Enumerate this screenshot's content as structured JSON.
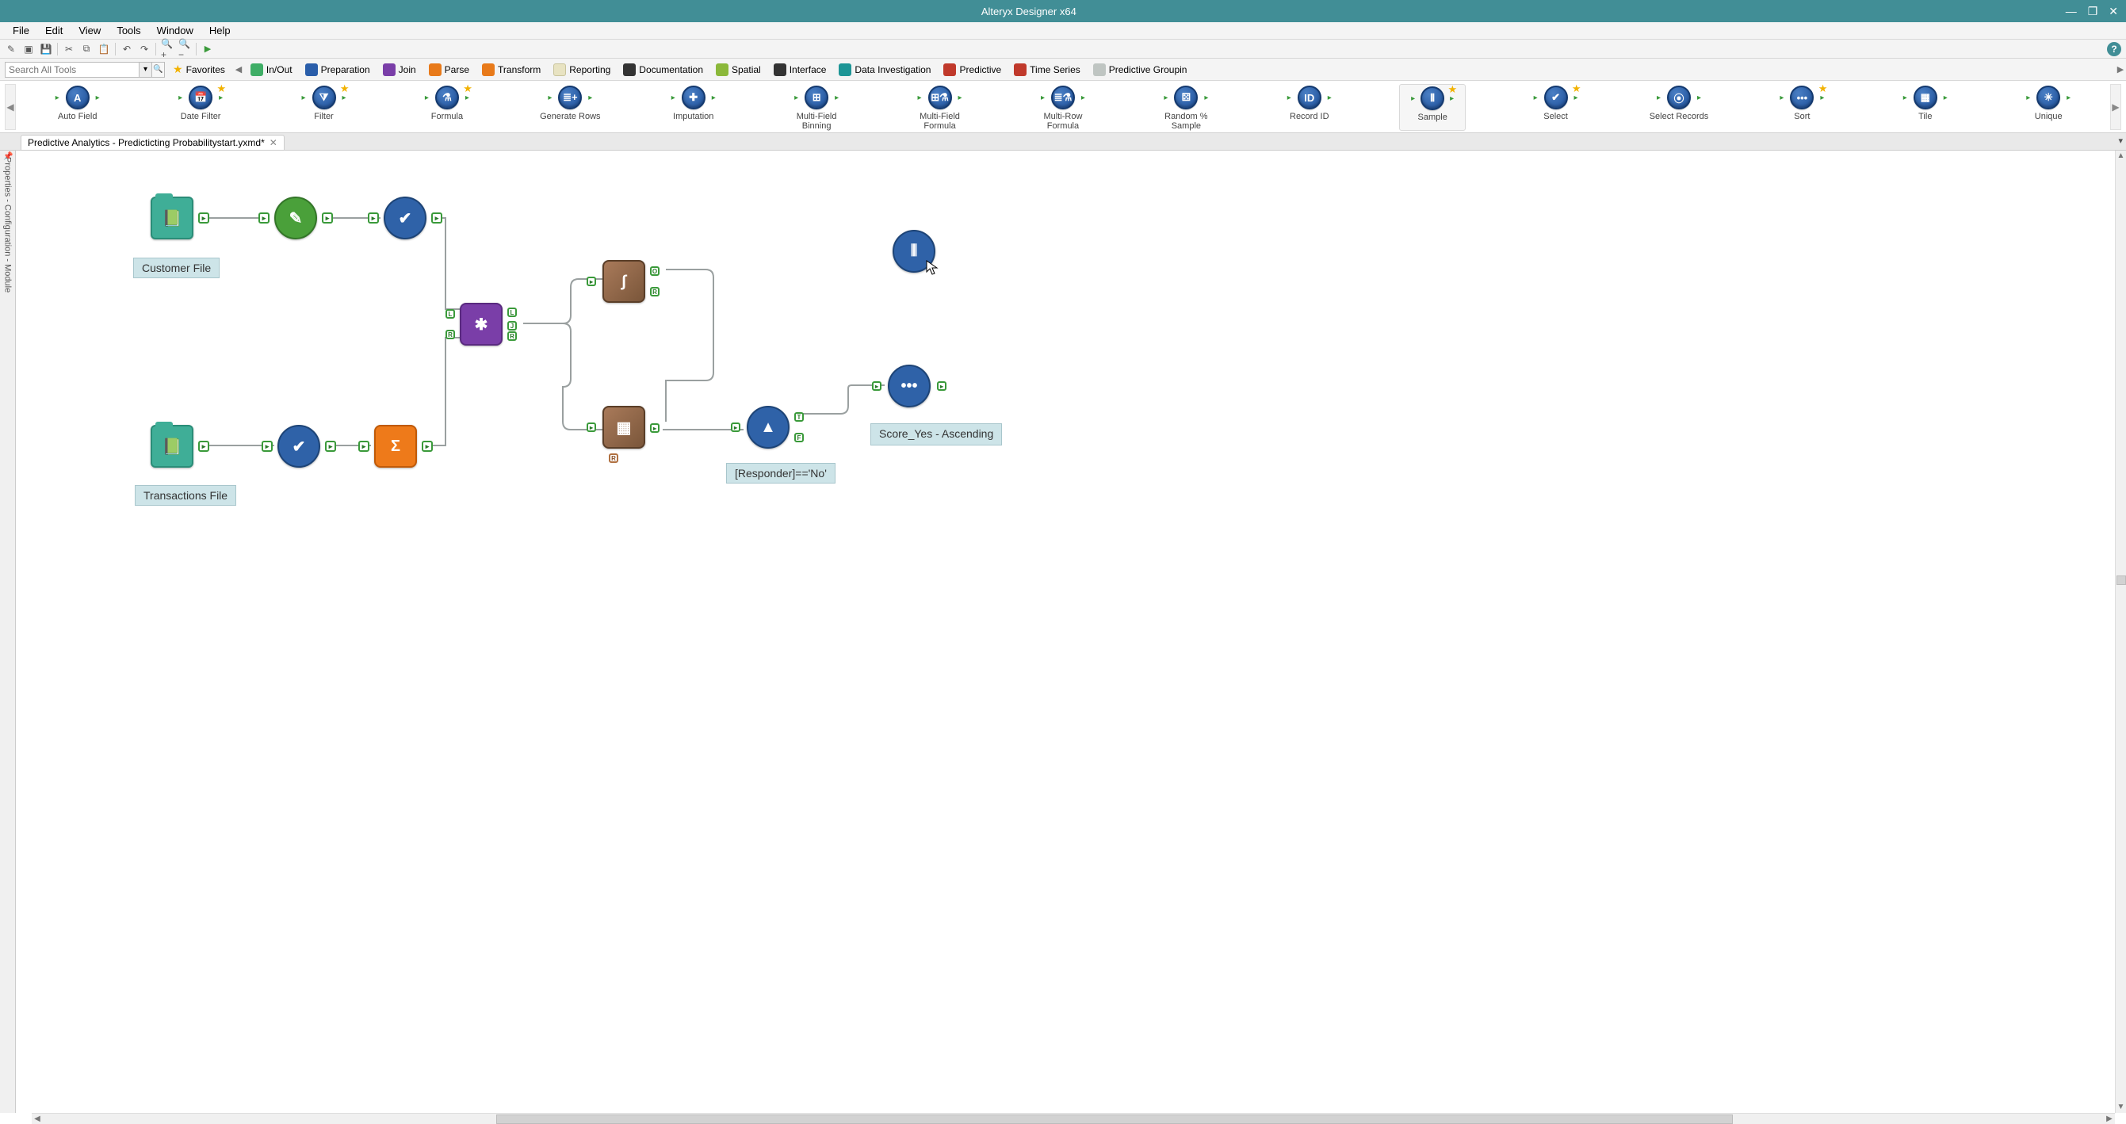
{
  "window": {
    "title": "Alteryx Designer x64",
    "min": "—",
    "restore": "❐",
    "close": "✕"
  },
  "menu": [
    "File",
    "Edit",
    "View",
    "Tools",
    "Window",
    "Help"
  ],
  "small_toolbar": {
    "icons": [
      "✎",
      "▣",
      "💾",
      "|",
      "✂",
      "⧉",
      "📋",
      "|",
      "↶",
      "↷",
      "|",
      "🔍+",
      "🔍−",
      "|"
    ],
    "run_title": "Run",
    "help": "?"
  },
  "ribbon": {
    "search_placeholder": "Search All Tools",
    "favorites": "Favorites",
    "categories": [
      {
        "label": "In/Out",
        "swatch": "sw-green"
      },
      {
        "label": "Preparation",
        "swatch": "sw-blue"
      },
      {
        "label": "Join",
        "swatch": "sw-purple"
      },
      {
        "label": "Parse",
        "swatch": "sw-orange"
      },
      {
        "label": "Transform",
        "swatch": "sw-orange"
      },
      {
        "label": "Reporting",
        "swatch": "sw-cream"
      },
      {
        "label": "Documentation",
        "swatch": "sw-dark"
      },
      {
        "label": "Spatial",
        "swatch": "sw-lime"
      },
      {
        "label": "Interface",
        "swatch": "sw-dark"
      },
      {
        "label": "Data Investigation",
        "swatch": "sw-teal"
      },
      {
        "label": "Predictive",
        "swatch": "sw-red"
      },
      {
        "label": "Time Series",
        "swatch": "sw-red"
      },
      {
        "label": "Predictive Groupin",
        "swatch": "sw-grey"
      }
    ]
  },
  "palette": [
    {
      "label": "Auto Field",
      "glyph": "A",
      "fav": false
    },
    {
      "label": "Date Filter",
      "glyph": "📅",
      "fav": true
    },
    {
      "label": "Filter",
      "glyph": "⧩",
      "fav": true
    },
    {
      "label": "Formula",
      "glyph": "⚗",
      "fav": true
    },
    {
      "label": "Generate Rows",
      "glyph": "≣+",
      "fav": false
    },
    {
      "label": "Imputation",
      "glyph": "✚",
      "fav": false
    },
    {
      "label": "Multi-Field Binning",
      "glyph": "⊞",
      "fav": false
    },
    {
      "label": "Multi-Field Formula",
      "glyph": "⊞⚗",
      "fav": false
    },
    {
      "label": "Multi-Row Formula",
      "glyph": "≣⚗",
      "fav": false
    },
    {
      "label": "Random % Sample",
      "glyph": "⚄",
      "fav": false
    },
    {
      "label": "Record ID",
      "glyph": "ID",
      "fav": false
    },
    {
      "label": "Sample",
      "glyph": "⦀",
      "fav": true,
      "selected": true
    },
    {
      "label": "Select",
      "glyph": "✔",
      "fav": true
    },
    {
      "label": "Select Records",
      "glyph": "⦿",
      "fav": false
    },
    {
      "label": "Sort",
      "glyph": "•••",
      "fav": true
    },
    {
      "label": "Tile",
      "glyph": "▦",
      "fav": false
    },
    {
      "label": "Unique",
      "glyph": "✳",
      "fav": false
    }
  ],
  "doc_tab": {
    "title": "Predictive Analytics - Predicticting Probabilitystart.yxmd*",
    "close_glyph": "✕"
  },
  "side_panel": {
    "label": "Properties - Configuration - Module"
  },
  "canvas": {
    "labels": {
      "customer": "Customer File",
      "transactions": "Transactions File",
      "filter_expr": "[Responder]=='No'",
      "sort_desc": "Score_Yes - Ascending"
    },
    "anchors": {
      "L": "L",
      "J": "J",
      "R": "R",
      "O": "O",
      "T": "T",
      "F": "F"
    },
    "nodes": {
      "input1": {
        "glyph": "📗",
        "name": "input-customer-file"
      },
      "data_cle": {
        "glyph": "✎",
        "name": "data-cleansing"
      },
      "select1": {
        "glyph": "✔",
        "name": "select-1"
      },
      "input2": {
        "glyph": "📗",
        "name": "input-transactions-file"
      },
      "select2": {
        "glyph": "✔",
        "name": "select-2"
      },
      "summ": {
        "glyph": "Σ",
        "name": "summarize"
      },
      "join": {
        "glyph": "✱",
        "name": "join"
      },
      "model": {
        "glyph": "∫",
        "name": "predictive-model"
      },
      "score": {
        "glyph": "▦",
        "name": "score"
      },
      "filter": {
        "glyph": "▲",
        "name": "filter"
      },
      "sort": {
        "glyph": "•••",
        "name": "sort"
      },
      "sample": {
        "glyph": "⦀",
        "name": "sample"
      }
    }
  }
}
